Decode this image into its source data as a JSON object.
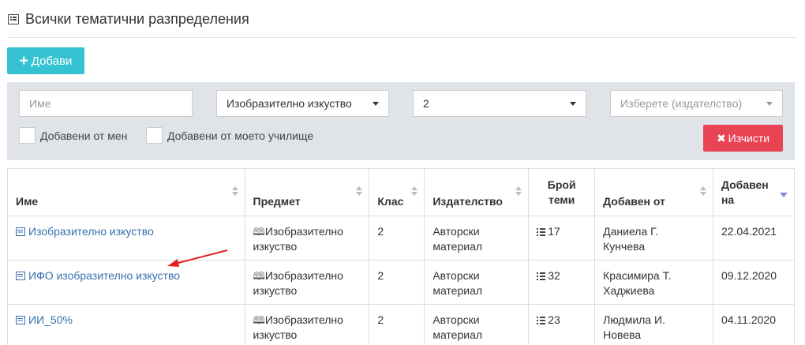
{
  "header": {
    "title": "Всички тематични разпределения",
    "icon": "list-icon"
  },
  "toolbar": {
    "add_label": "Добави"
  },
  "filters": {
    "name_placeholder": "Име",
    "subject_value": "Изобразително изкуство",
    "grade_value": "2",
    "publisher_placeholder": "Изберете (издателство)",
    "added_by_me_label": "Добавени от мен",
    "added_by_school_label": "Добавени от моето училище",
    "clear_label": "Изчисти"
  },
  "table": {
    "columns": {
      "name": "Име",
      "subject": "Предмет",
      "grade": "Клас",
      "publisher": "Издателство",
      "topics_1": "Брой",
      "topics_2": "теми",
      "added_by": "Добавен от",
      "added_on_1": "Добавен",
      "added_on_2": "на"
    },
    "rows": [
      {
        "name": "Изобразително изкуство",
        "subject_1": "Изобразително",
        "subject_2": "изкуство",
        "grade": "2",
        "publisher_1": "Авторски",
        "publisher_2": "материал",
        "topics": "17",
        "added_by_1": "Даниела Г.",
        "added_by_2": "Кунчева",
        "added_on": "22.04.2021"
      },
      {
        "name": "ИФО изобразително изкуство",
        "subject_1": "Изобразително",
        "subject_2": "изкуство",
        "grade": "2",
        "publisher_1": "Авторски",
        "publisher_2": "материал",
        "topics": "32",
        "added_by_1": "Красимира Т.",
        "added_by_2": "Хаджиева",
        "added_on": "09.12.2020"
      },
      {
        "name": "ИИ_50%",
        "subject_1": "Изобразително",
        "subject_2": "изкуство",
        "grade": "2",
        "publisher_1": "Авторски",
        "publisher_2": "материал",
        "topics": "23",
        "added_by_1": "Людмила И.",
        "added_by_2": "Новева",
        "added_on": "04.11.2020"
      }
    ]
  },
  "colors": {
    "add_button": "#35c3d2",
    "clear_button": "#e84454",
    "link": "#3a6fb0",
    "filter_bg": "#e0e4e9",
    "annotation_arrow": "#e02020"
  }
}
